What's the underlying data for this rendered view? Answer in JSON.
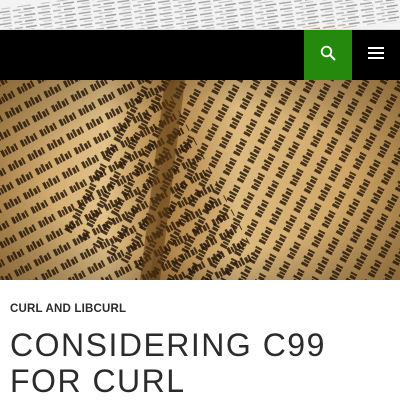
{
  "header": {
    "search_icon": "search-icon",
    "menu_icon": "hamburger-menu-icon",
    "accent_color": "#24890d",
    "bar_color": "#000000"
  },
  "hero": {
    "image": "old-book-gothic-script-photo"
  },
  "post": {
    "category": "CURL AND LIBCURL",
    "title": "CONSIDERING C99 FOR CURL"
  }
}
